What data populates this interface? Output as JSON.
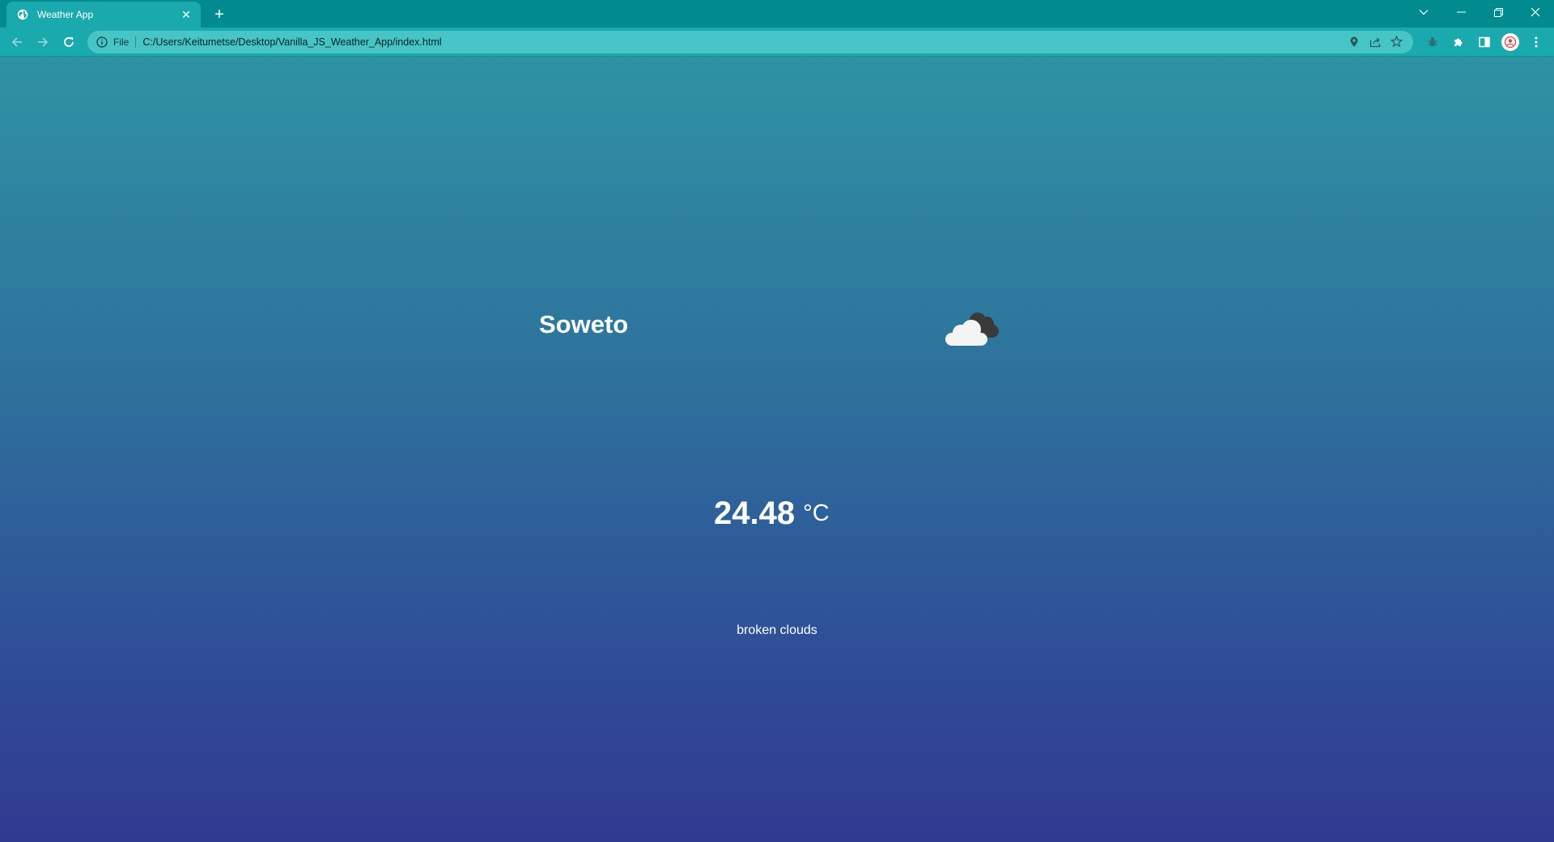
{
  "browser": {
    "tab_title": "Weather App",
    "new_tab_symbol": "+",
    "close_symbol": "✕",
    "address_scheme": "File",
    "address_url": "C:/Users/Keitumetse/Desktop/Vanilla_JS_Weather_App/index.html",
    "window_controls": [
      "chevron-down-icon",
      "minimize-icon",
      "restore-icon",
      "close-icon"
    ],
    "toolbar_icons": [
      "location-icon",
      "share-icon",
      "star-icon",
      "extension-bug-icon",
      "puzzle-icon",
      "side-panel-icon",
      "profile-avatar",
      "menu-icon"
    ]
  },
  "weather": {
    "city": "Soweto",
    "temperature": "24.48",
    "unit": "°C",
    "description": "broken clouds",
    "icon": "broken-clouds-icon"
  },
  "colors": {
    "tab_strip": "#028b8f",
    "toolbar": "#1aa9ad",
    "omnibox": "#47c4c6",
    "gradient_top": "#2e93a3",
    "gradient_bottom": "#303a90",
    "text": "#ffffff"
  }
}
